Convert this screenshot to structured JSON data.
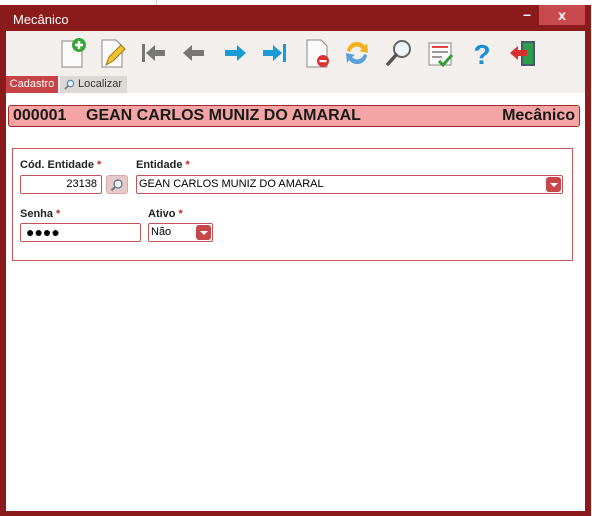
{
  "window": {
    "title": "Mecânico",
    "minimize_label": "–",
    "close_label": "x"
  },
  "toolbar": {
    "buttons": [
      {
        "name": "new-record-icon"
      },
      {
        "name": "edit-record-icon"
      },
      {
        "name": "first-record-icon"
      },
      {
        "name": "previous-record-icon"
      },
      {
        "name": "next-record-icon"
      },
      {
        "name": "last-record-icon"
      },
      {
        "name": "delete-record-icon"
      },
      {
        "name": "refresh-icon"
      },
      {
        "name": "search-icon"
      },
      {
        "name": "report-checklist-icon"
      },
      {
        "name": "help-icon"
      },
      {
        "name": "exit-icon"
      }
    ]
  },
  "tabs": {
    "cadastro": "Cadastro",
    "localizar": "Localizar"
  },
  "header": {
    "code": "000001",
    "name": "GEAN CARLOS MUNIZ DO AMARAL",
    "type": "Mecânico"
  },
  "form": {
    "cod_entidade_label": "Cód. Entidade",
    "cod_entidade_value": "23138",
    "entidade_label": "Entidade",
    "entidade_value": "GEAN CARLOS MUNIZ DO AMARAL",
    "senha_label": "Senha",
    "senha_value": "●●●●",
    "ativo_label": "Ativo",
    "ativo_value": "Não",
    "required_mark": "*"
  },
  "colors": {
    "frame": "#8a1a1b",
    "accent": "#c64347",
    "header_bg": "#f4a4a4"
  }
}
